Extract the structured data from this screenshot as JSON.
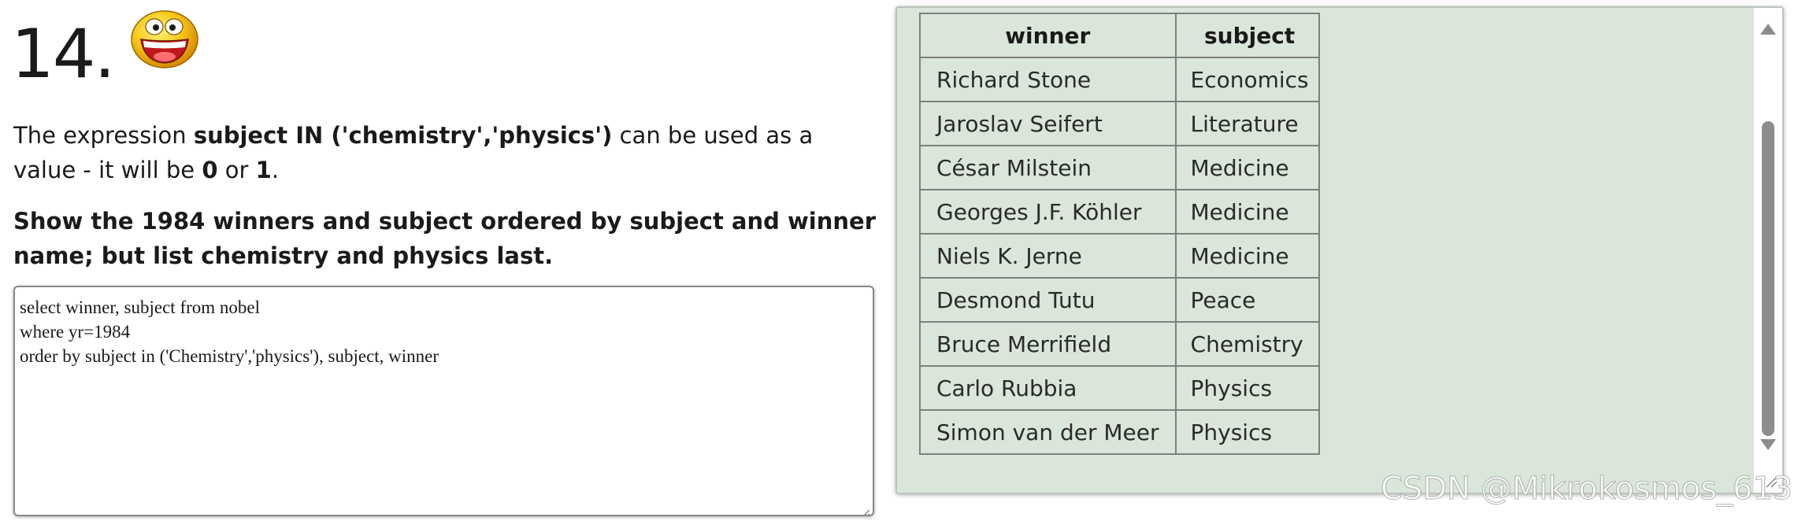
{
  "question": {
    "number": "14.",
    "icon": "laughing-smiley-icon",
    "desc_part1": "The expression ",
    "desc_bold_expr": "subject IN ('chemistry','physics')",
    "desc_part2": " can be used as a value - it will be ",
    "desc_bold_zero": "0",
    "desc_part3": " or ",
    "desc_bold_one": "1",
    "desc_part4": ".",
    "task": "Show the 1984 winners and subject ordered by subject and winner name; but list chemistry and physics last."
  },
  "editor": {
    "lines": [
      "select winner, subject from nobel",
      "where yr=1984",
      "order by subject in ('Chemistry','physics'), subject, winner"
    ]
  },
  "results": {
    "columns": [
      "winner",
      "subject"
    ],
    "rows": [
      [
        "Richard Stone",
        "Economics"
      ],
      [
        "Jaroslav Seifert",
        "Literature"
      ],
      [
        "César Milstein",
        "Medicine"
      ],
      [
        "Georges J.F. Köhler",
        "Medicine"
      ],
      [
        "Niels K. Jerne",
        "Medicine"
      ],
      [
        "Desmond Tutu",
        "Peace"
      ],
      [
        "Bruce Merrifield",
        "Chemistry"
      ],
      [
        "Carlo Rubbia",
        "Physics"
      ],
      [
        "Simon van der Meer",
        "Physics"
      ]
    ]
  },
  "watermark": "CSDN @Mikrokosmos_613",
  "colors": {
    "results_bg": "#dae6da",
    "table_border": "#7f7f7f",
    "scroll_thumb": "#8d8d8d"
  }
}
